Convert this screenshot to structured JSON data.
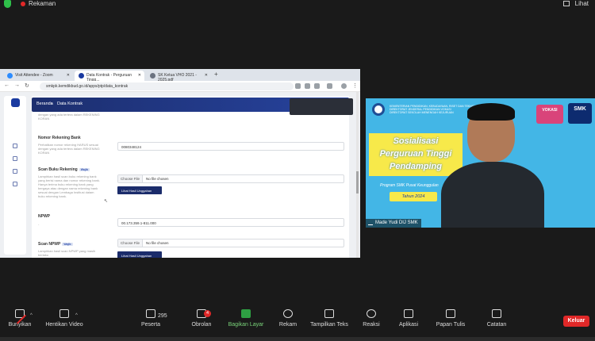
{
  "top_bar": {
    "recording_label": "Rekaman",
    "view_label": "Lihat",
    "colors": {
      "shield": "#2fbf4a",
      "recording": "#e02828"
    }
  },
  "browser": {
    "tabs": [
      {
        "label": "Visit Attendee - Zoom",
        "icon": "zoom-icon"
      },
      {
        "label": "Data Kontrak - Perguruan Tingg...",
        "icon": "kemdikbud-icon"
      },
      {
        "label": "SK Ketua VHO 2021 - 2025.pdf",
        "icon": "pdf-icon"
      }
    ],
    "url": "smkpk.kemdikbud.go.id/apps/ptp/data_kontrak"
  },
  "page": {
    "breadcrumb": {
      "home": "Beranda",
      "current": "Data Kontrak"
    },
    "top_hint": "dengan yang ada tertera dalam REKENING KORAN",
    "nomor_rekening": {
      "label": "Nomor Rekening Bank",
      "hint": "Perhatikan nomor rekening HARUS sesuai dengan yang ada tertera dalam REKENING KORAN",
      "value": "0080348124"
    },
    "scan_buku": {
      "label": "Scan Buku Rekening",
      "badge": "Wajib",
      "hint": "Lampirkan hasil scan buku rekening bank yang berisi nama dan nomor rekening bank. Hanya terima buku rekening bank yang bergaya atau dengan nama rekening bank sesuai dengan Lembaga Institusi dalam buku rekening bank.",
      "choose_label": "Choose File",
      "file_status": "No file chosen",
      "button": "Lihat Hasil Unggahan"
    },
    "npwp": {
      "label": "NPWP",
      "hint": "-",
      "value": "00.173.359.1-811.000"
    },
    "scan_npwp": {
      "label": "Scan NPWP",
      "badge": "Wajib",
      "hint": "Lampirkan hasil scan NPWP yang masih berlaku",
      "choose_label": "Choose File",
      "file_status": "No file chosen",
      "button": "Lihat Hasil Unggahan"
    }
  },
  "video": {
    "participant_name": "Made Yudi DIJ SMK",
    "slide": {
      "org_lines": [
        "KEMENTERIAN PENDIDIKAN, KEBUDAYAAN, RISET DAN TEKNOLOGI",
        "DIREKTORAT JENDERAL PENDIDIKAN VOKASI",
        "DIREKTORAT SEKOLAH MENENGAH KEJURUAN"
      ],
      "title_lines": [
        "Sosialisasi",
        "Perguruan Tinggi",
        "Pendamping"
      ],
      "program": "Program SMK Pusat Keunggulan",
      "year": "Tahun 2024",
      "badge_left": "VOKASI",
      "badge_right": "SMK"
    },
    "colors": {
      "background": "#43b6e6",
      "title_bg": "#f7e94a"
    }
  },
  "toolbar": {
    "items": [
      {
        "label": "Bunyikan",
        "icon": "microphone-muted-icon"
      },
      {
        "label": "Hentikan Video",
        "icon": "video-camera-icon"
      },
      {
        "label": "Peserta",
        "icon": "participants-icon",
        "count": "295"
      },
      {
        "label": "Obrolan",
        "icon": "chat-icon",
        "badge": "4"
      },
      {
        "label": "Bagikan Layar",
        "icon": "share-screen-icon"
      },
      {
        "label": "Rekam",
        "icon": "record-icon"
      },
      {
        "label": "Tampilkan Teks",
        "icon": "captions-icon"
      },
      {
        "label": "Reaksi",
        "icon": "reactions-icon"
      },
      {
        "label": "Aplikasi",
        "icon": "apps-icon"
      },
      {
        "label": "Papan Tulis",
        "icon": "whiteboard-icon"
      },
      {
        "label": "Catatan",
        "icon": "notes-icon"
      }
    ],
    "leave_label": "Keluar",
    "colors": {
      "share": "#2ea043",
      "leave": "#e02828"
    }
  }
}
